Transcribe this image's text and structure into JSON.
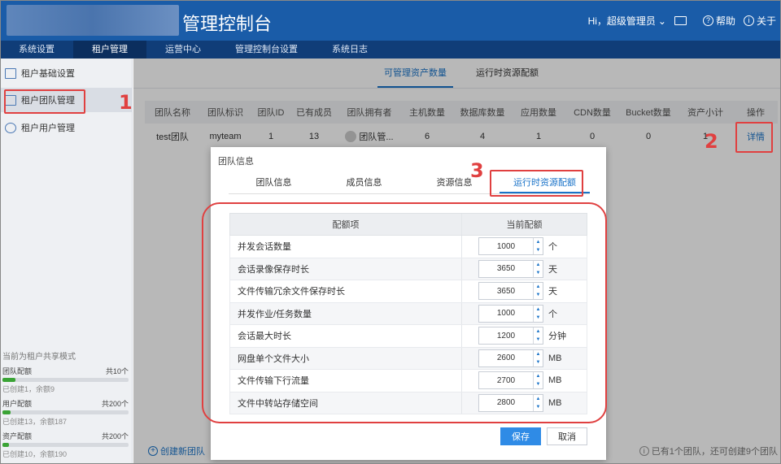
{
  "header": {
    "title": "管理控制台",
    "user": "Hi，超级管理员",
    "help": "帮助",
    "about": "关于"
  },
  "nav": [
    "系统设置",
    "租户管理",
    "运营中心",
    "管理控制台设置",
    "系统日志"
  ],
  "sidebar": {
    "items": [
      "租户基础设置",
      "租户团队管理",
      "租户用户管理"
    ],
    "quota_title": "当前为租户共享模式",
    "quotas": [
      {
        "label": "团队配额",
        "total": "共10个",
        "sub": "已创建1，余额9",
        "fill": 0.1
      },
      {
        "label": "用户配额",
        "total": "共200个",
        "sub": "已创建13，余额187",
        "fill": 0.065
      },
      {
        "label": "资产配额",
        "total": "共200个",
        "sub": "已创建10，余额190",
        "fill": 0.05
      }
    ]
  },
  "main": {
    "tabs": [
      "可管理资产数量",
      "运行时资源配额"
    ],
    "columns": [
      "团队名称",
      "团队标识",
      "团队ID",
      "已有成员",
      "团队拥有者",
      "主机数量",
      "数据库数量",
      "应用数量",
      "CDN数量",
      "Bucket数量",
      "资产小计",
      "操作"
    ],
    "row": [
      "test团队",
      "myteam",
      "1",
      "13",
      "团队管...",
      "6",
      "4",
      "1",
      "0",
      "0",
      "1",
      "详情"
    ],
    "create_link": "创建新团队",
    "footer_info": "已有1个团队，还可创建9个团队"
  },
  "modal": {
    "title": "团队信息",
    "tabs": [
      "团队信息",
      "成员信息",
      "资源信息",
      "运行时资源配额"
    ],
    "table_head": [
      "配额项",
      "当前配额"
    ],
    "rows": [
      {
        "name": "并发会话数量",
        "value": "1000",
        "unit": "个"
      },
      {
        "name": "会话录像保存时长",
        "value": "3650",
        "unit": "天"
      },
      {
        "name": "文件传输冗余文件保存时长",
        "value": "3650",
        "unit": "天"
      },
      {
        "name": "并发作业/任务数量",
        "value": "1000",
        "unit": "个"
      },
      {
        "name": "会话最大时长",
        "value": "1200",
        "unit": "分钟"
      },
      {
        "name": "网盘单个文件大小",
        "value": "2600",
        "unit": "MB"
      },
      {
        "name": "文件传输下行流量",
        "value": "2700",
        "unit": "MB"
      },
      {
        "name": "文件中转站存储空间",
        "value": "2800",
        "unit": "MB"
      }
    ],
    "save": "保存",
    "cancel": "取消"
  },
  "annotations": [
    "1",
    "2",
    "3"
  ],
  "colors": {
    "header": "#1a5ca8",
    "nav": "#103d78",
    "accent": "#1a73c8",
    "annotation": "#e04040"
  }
}
